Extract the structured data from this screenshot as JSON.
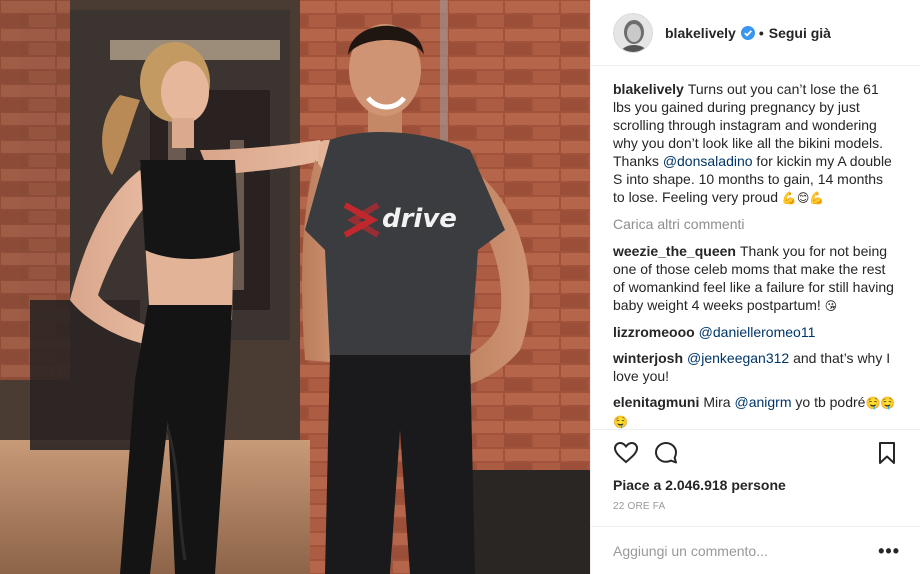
{
  "post": {
    "username": "blakelively",
    "follow_label": "Segui già",
    "separator": "•",
    "shirt_text": "drive",
    "caption": {
      "user": "blakelively",
      "text_1": "Turns out you can’t lose the 61 lbs you gained during pregnancy by just scrolling through instagram and wondering why you don’t look like all the bikini models. Thanks ",
      "mention": "@donsaladino",
      "text_2": " for kickin my A double S into shape. 10 months to gain, 14 months to lose. Feeling very proud ",
      "emojis": "💪😊💪"
    },
    "load_more": "Carica altri commenti",
    "comments": [
      {
        "user": "weezie_the_queen",
        "text_1": "Thank you for not being one of those celeb moms that make the rest of womankind feel like a failure for still having baby weight 4 weeks postpartum! ",
        "mention": "",
        "text_2": "",
        "emoji": "😘"
      },
      {
        "user": "lizzromeooo",
        "text_1": "",
        "mention": "@danielleromeo11",
        "text_2": "",
        "emoji": ""
      },
      {
        "user": "winterjosh",
        "text_1": "",
        "mention": "@jenkeegan312",
        "text_2": " and that’s why I love you!",
        "emoji": ""
      },
      {
        "user": "elenitagmuni",
        "text_1": "Mira ",
        "mention": "@anigrm",
        "text_2": " yo tb podré",
        "emoji": "🤤🤤🤤"
      }
    ],
    "likes": "Piace a 2.046.918 persone",
    "time": "22 ore fa",
    "comment_placeholder": "Aggiungi un commento...",
    "more_label": "•••",
    "icons": {
      "avatar": "avatar",
      "verified": "verified-badge-icon",
      "like": "heart-icon",
      "comment": "comment-bubble-icon",
      "save": "bookmark-icon"
    },
    "colors": {
      "verified": "#3897f0",
      "mention": "#003569",
      "muted": "#8e8e8e"
    }
  }
}
